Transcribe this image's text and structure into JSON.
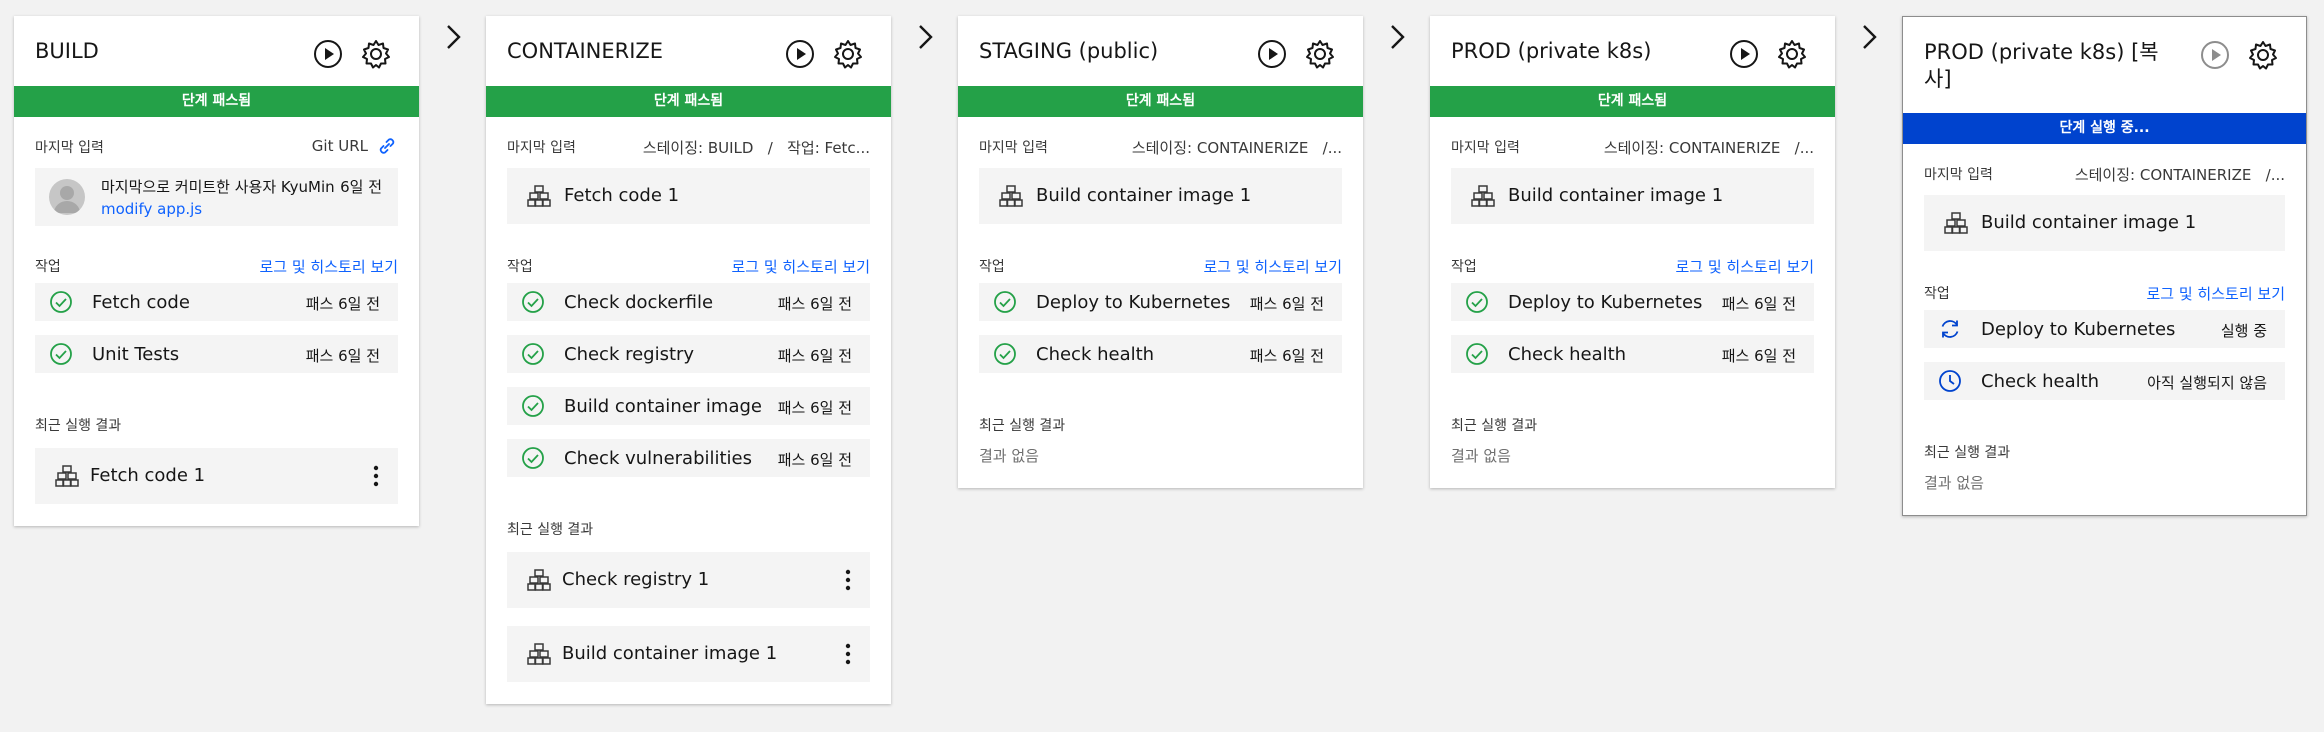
{
  "labels": {
    "last_input": "마지막 입력",
    "jobs": "작업",
    "jobs_link": "로그 및 히스토리 보기",
    "recent_results": "최근 실행 결과",
    "no_results": "결과 없음"
  },
  "colors": {
    "passed": "#24a148",
    "running": "#0043ce",
    "link": "#0f62fe"
  },
  "stages": [
    {
      "title": "BUILD",
      "status": "단계 패스됨",
      "input_source": "Git URL",
      "commit": {
        "message": "마지막으로 커미트한 사용자 KyuMin",
        "time": "6일 전",
        "file": "modify app.js"
      },
      "jobs": [
        {
          "name": "Fetch code",
          "status": "패스 6일 전",
          "icon": "check-circle-icon"
        },
        {
          "name": "Unit Tests",
          "status": "패스 6일 전",
          "icon": "check-circle-icon"
        }
      ],
      "results": [
        {
          "name": "Fetch code 1"
        }
      ]
    },
    {
      "title": "CONTAINERIZE",
      "status": "단계 패스됨",
      "input_source": "스테이징: BUILD   /   작업: Fetc...",
      "input_item": "Fetch code 1",
      "jobs": [
        {
          "name": "Check dockerfile",
          "status": "패스 6일 전",
          "icon": "check-circle-icon"
        },
        {
          "name": "Check registry",
          "status": "패스 6일 전",
          "icon": "check-circle-icon"
        },
        {
          "name": "Build container image",
          "status": "패스 6일 전",
          "icon": "check-circle-icon"
        },
        {
          "name": "Check vulnerabilities",
          "status": "패스 6일 전",
          "icon": "check-circle-icon"
        }
      ],
      "results": [
        {
          "name": "Check registry 1"
        },
        {
          "name": "Build container image 1"
        }
      ]
    },
    {
      "title": "STAGING (public)",
      "status": "단계 패스됨",
      "input_source": "스테이징: CONTAINERIZE   /...",
      "input_item": "Build container image 1",
      "jobs": [
        {
          "name": "Deploy to Kubernetes",
          "status": "패스 6일 전",
          "icon": "check-circle-icon"
        },
        {
          "name": "Check health",
          "status": "패스 6일 전",
          "icon": "check-circle-icon"
        }
      ],
      "results": []
    },
    {
      "title": "PROD (private k8s)",
      "status": "단계 패스됨",
      "input_source": "스테이징: CONTAINERIZE   /...",
      "input_item": "Build container image 1",
      "jobs": [
        {
          "name": "Deploy to Kubernetes",
          "status": "패스 6일 전",
          "icon": "check-circle-icon"
        },
        {
          "name": "Check health",
          "status": "패스 6일 전",
          "icon": "check-circle-icon"
        }
      ],
      "results": []
    },
    {
      "title": "PROD (private k8s) [복사]",
      "status": "단계 실행 중...",
      "input_source": "스테이징: CONTAINERIZE   /...",
      "input_item": "Build container image 1",
      "jobs": [
        {
          "name": "Deploy to Kubernetes",
          "status": "실행 중",
          "icon": "sync-icon"
        },
        {
          "name": "Check health",
          "status": "아직 실행되지 않음",
          "icon": "clock-icon"
        }
      ],
      "results": []
    }
  ]
}
